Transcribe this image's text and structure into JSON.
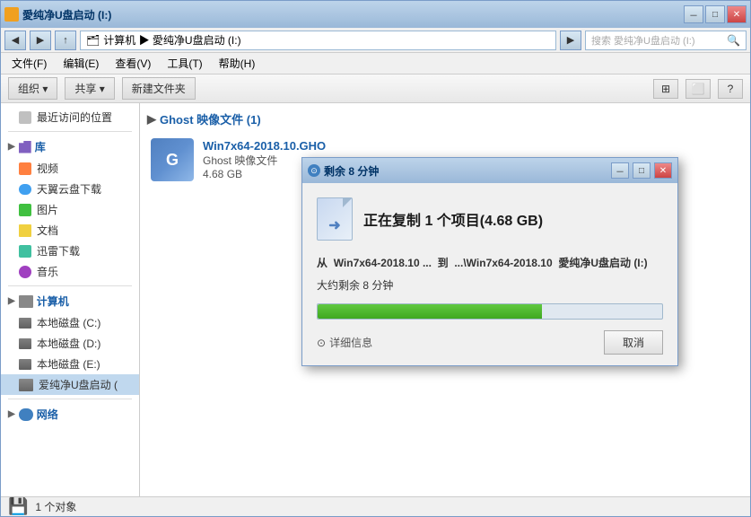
{
  "window": {
    "title": "愛纯净U盘启动 (I:)",
    "min_label": "－",
    "max_label": "□",
    "close_label": "✕"
  },
  "address_bar": {
    "path": "计算机 ▶ 愛纯净U盘启动 (I:)",
    "search_placeholder": "搜索 愛纯净U盘启动 (I:)"
  },
  "menu": {
    "items": [
      "文件(F)",
      "编辑(E)",
      "查看(V)",
      "工具(T)",
      "帮助(H)"
    ]
  },
  "toolbar": {
    "organize": "组织 ▾",
    "share": "共享 ▾",
    "new_folder": "新建文件夹",
    "view_icon": "⊞",
    "pane_icon": "⬜",
    "help_icon": "?"
  },
  "sidebar": {
    "recent": "最近访问的位置",
    "library_label": "库",
    "video": "视频",
    "cloud": "天翼云盘下载",
    "images": "图片",
    "docs": "文档",
    "downloads": "迅雷下载",
    "music": "音乐",
    "computer_label": "计算机",
    "drive_c": "本地磁盘 (C:)",
    "drive_d": "本地磁盘 (D:)",
    "drive_e": "本地磁盘 (E:)",
    "drive_i": "爱纯净U盘启动 (",
    "network_label": "网络"
  },
  "content": {
    "group_header": "Ghost 映像文件 (1)",
    "file_name": "Win7x64-2018.10.GHO",
    "file_type": "Ghost 映像文件",
    "file_size": "4.68 GB"
  },
  "status_bar": {
    "count": "1 个对象"
  },
  "dialog": {
    "title": "剩余 8 分钟",
    "main_text": "正在复制 1 个项目(4.68 GB)",
    "from_label": "从",
    "from_path": "Win7x64-2018.10 ...",
    "to_label": "到",
    "to_path": "...\\Win7x64-2018.10",
    "to_dest": "愛纯净U盘启动 (I:)",
    "time_text": "大约剩余 8 分钟",
    "progress_percent": 65,
    "detail_btn": "详细信息",
    "cancel_btn": "取消",
    "min_label": "－",
    "max_label": "□",
    "close_label": "✕",
    "chevron": "⊙"
  }
}
